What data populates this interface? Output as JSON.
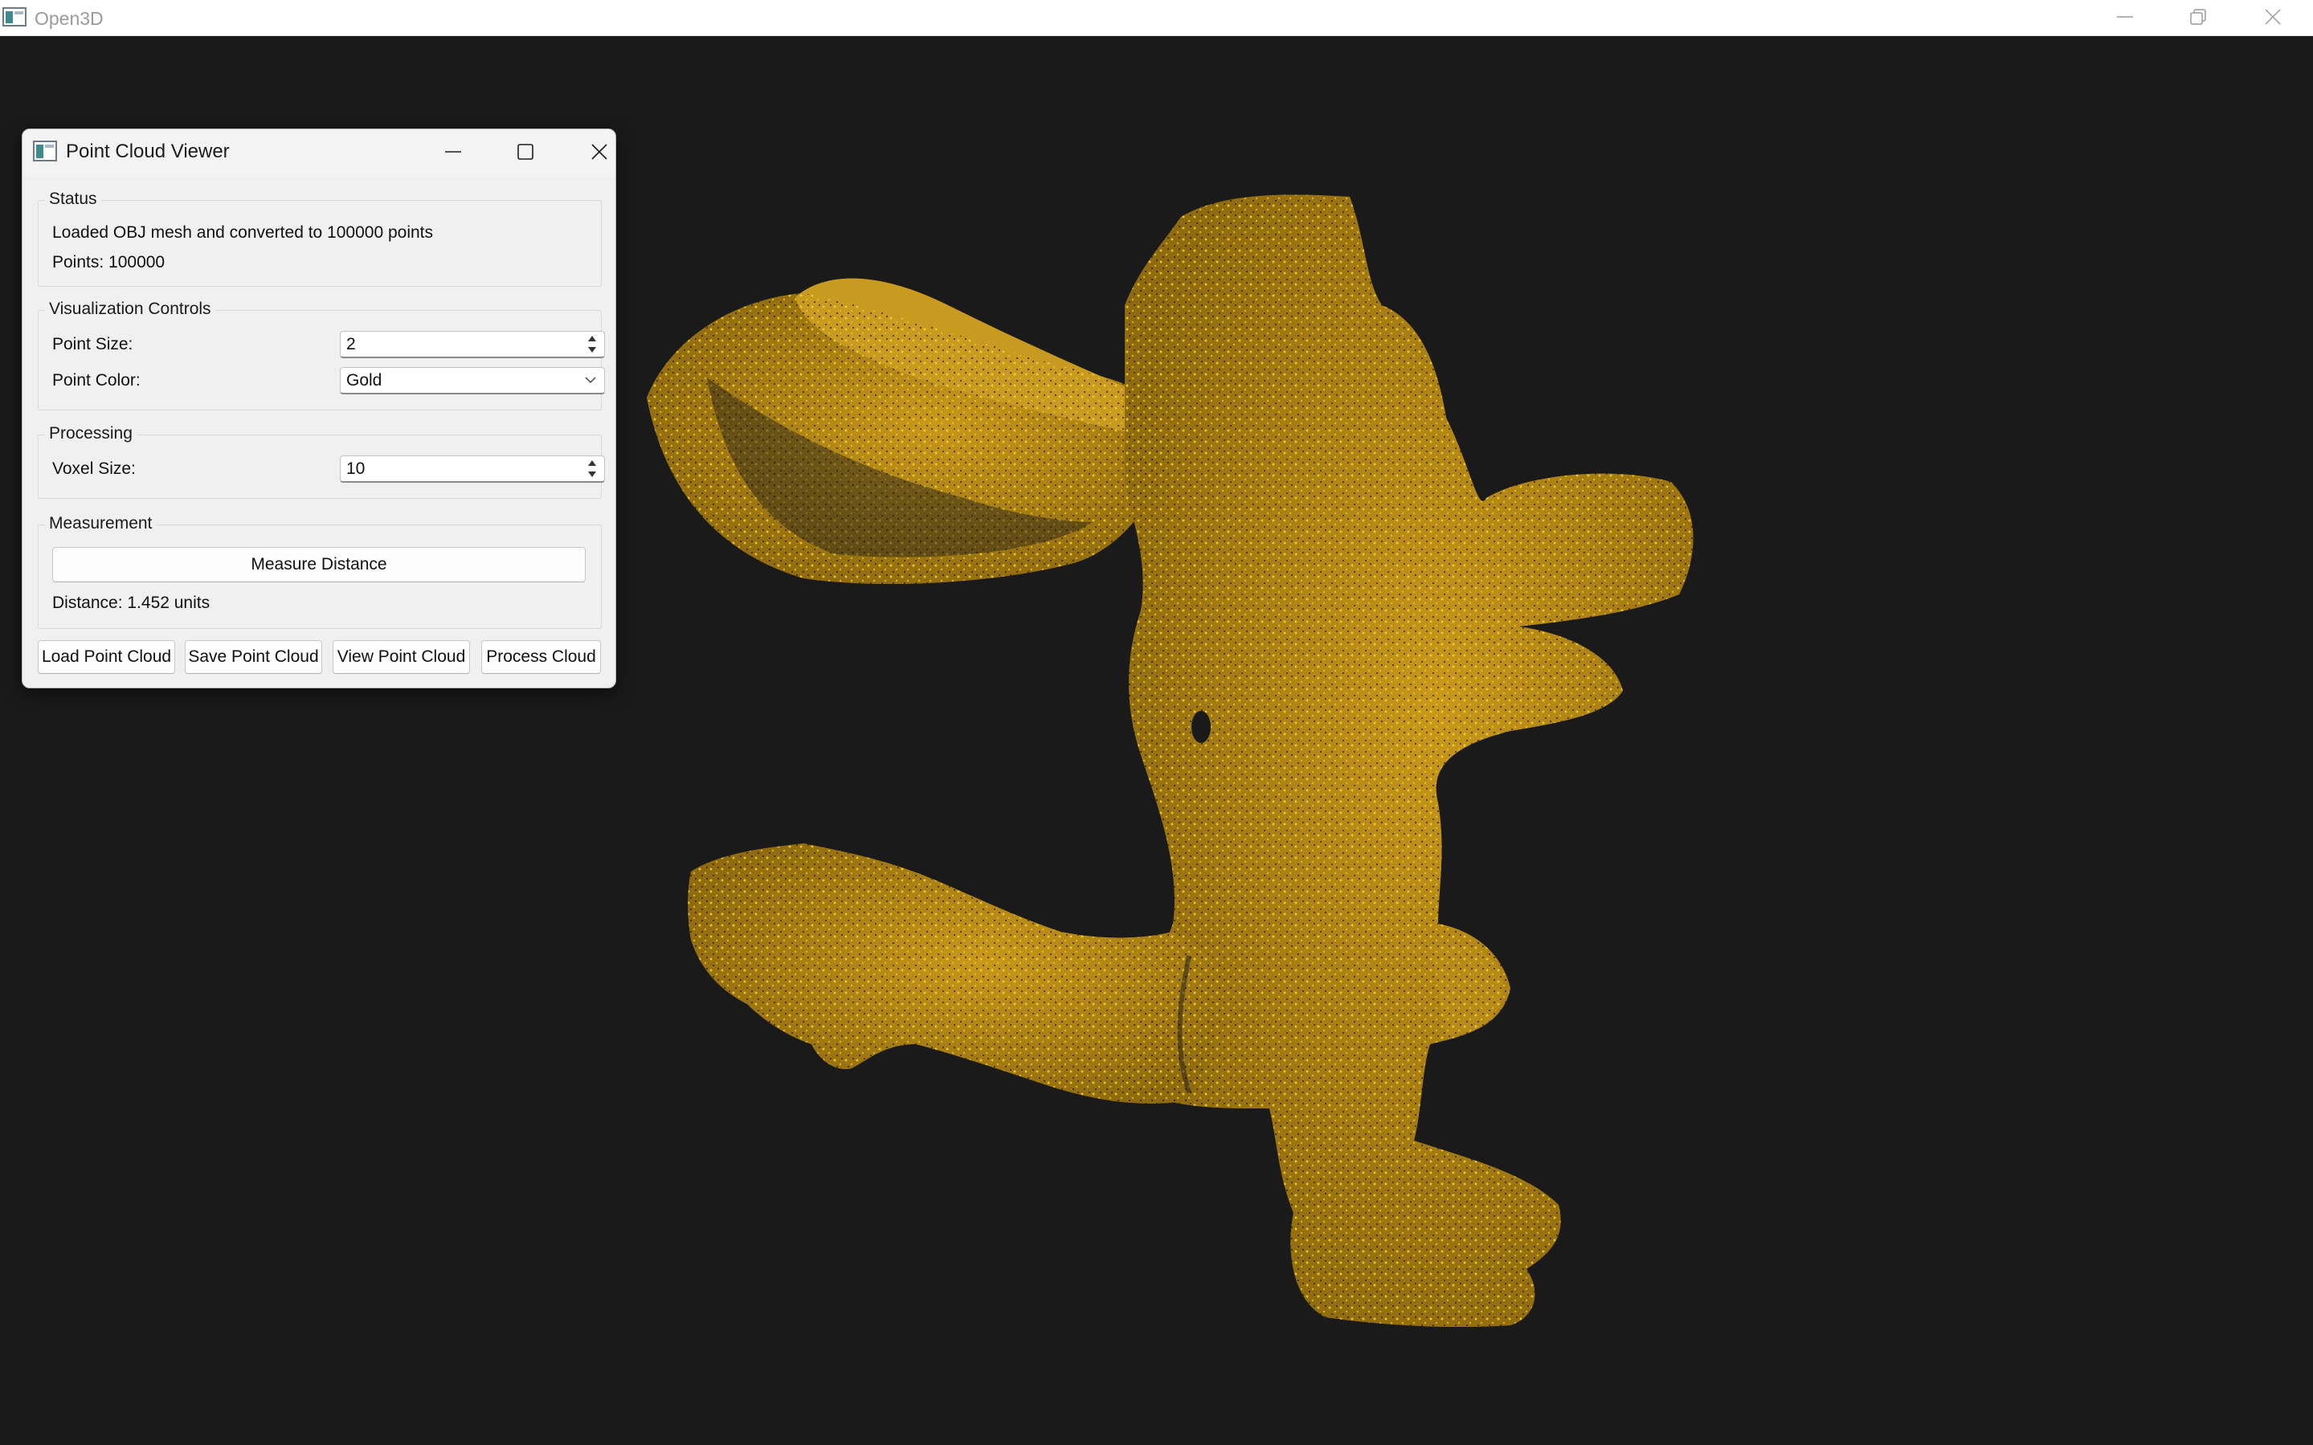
{
  "app_window": {
    "title": "Open3D",
    "icon": "app-window-icon",
    "controls": [
      "minimize-icon",
      "restore-icon",
      "close-icon"
    ]
  },
  "viewer": {
    "background_color": "#1a1a1a",
    "point_color": "#d4a418"
  },
  "dialog": {
    "title": "Point Cloud Viewer",
    "icon": "app-window-icon",
    "controls": [
      "minimize-icon",
      "maximize-icon",
      "close-icon"
    ],
    "status": {
      "group_title": "Status",
      "message": "Loaded OBJ mesh and converted to 100000 points",
      "points_text": "Points: 100000"
    },
    "visualization": {
      "group_title": "Visualization Controls",
      "point_size_label": "Point Size:",
      "point_size_value": "2",
      "point_color_label": "Point Color:",
      "point_color_value": "Gold"
    },
    "processing": {
      "group_title": "Processing",
      "voxel_size_label": "Voxel Size:",
      "voxel_size_value": "10"
    },
    "measurement": {
      "group_title": "Measurement",
      "measure_button": "Measure Distance",
      "distance_text": "Distance: 1.452 units"
    },
    "buttons": {
      "load": "Load Point Cloud",
      "save": "Save Point Cloud",
      "view": "View Point Cloud",
      "process": "Process Cloud"
    }
  }
}
